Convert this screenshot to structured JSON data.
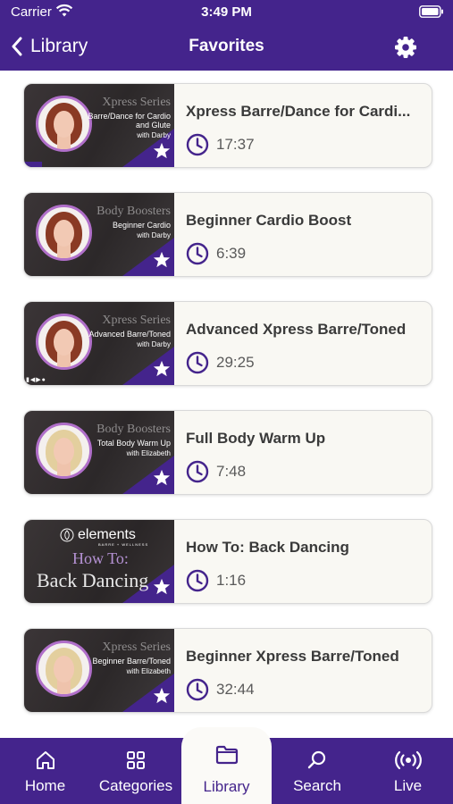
{
  "status_bar": {
    "carrier": "Carrier",
    "time": "3:49 PM"
  },
  "nav": {
    "back_label": "Library",
    "title": "Favorites"
  },
  "colors": {
    "accent": "#44248c",
    "card_bg": "#f9f8f3",
    "ring": "#b06fc9"
  },
  "favorites": [
    {
      "title": "Xpress Barre/Dance for Cardi...",
      "duration": "17:37",
      "thumb": {
        "series": "Xpress Series",
        "subtitle": "Barre/Dance for Cardio and Glute",
        "with": "with Darby"
      }
    },
    {
      "title": "Beginner Cardio Boost",
      "duration": "6:39",
      "thumb": {
        "series": "Body Boosters",
        "subtitle": "Beginner Cardio",
        "with": "with Darby"
      }
    },
    {
      "title": "Advanced Xpress Barre/Toned",
      "duration": "29:25",
      "thumb": {
        "series": "Xpress Series",
        "subtitle": "Advanced Barre/Toned",
        "with": "with Darby"
      }
    },
    {
      "title": "Full Body Warm Up",
      "duration": "7:48",
      "thumb": {
        "series": "Body Boosters",
        "subtitle": "Total Body Warm Up",
        "with": "with Elizabeth"
      }
    },
    {
      "title": "How To: Back Dancing",
      "duration": "1:16",
      "thumb": {
        "brand": "elements",
        "brand_sub": "BARRE + WELLNESS",
        "line1": "How To:",
        "line2": "Back Dancing"
      }
    },
    {
      "title": "Beginner Xpress Barre/Toned",
      "duration": "32:44",
      "thumb": {
        "series": "Xpress Series",
        "subtitle": "Beginner Barre/Toned",
        "with": "with Elizabeth"
      }
    }
  ],
  "tabs": [
    {
      "label": "Home",
      "icon": "home-icon"
    },
    {
      "label": "Categories",
      "icon": "grid-icon"
    },
    {
      "label": "Library",
      "icon": "folder-icon",
      "active": true
    },
    {
      "label": "Search",
      "icon": "search-icon"
    },
    {
      "label": "Live",
      "icon": "broadcast-icon"
    }
  ]
}
